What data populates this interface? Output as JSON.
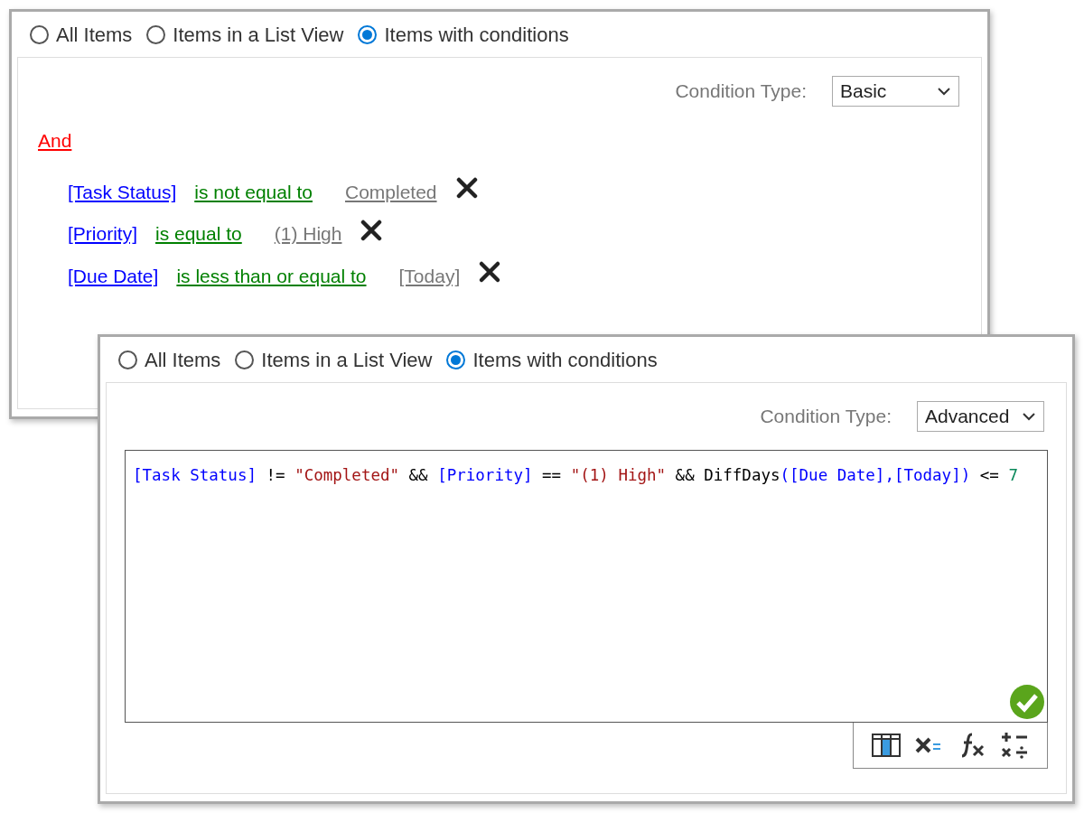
{
  "panels": [
    {
      "kind": "basic",
      "options": [
        {
          "label": "All Items",
          "selected": false
        },
        {
          "label": "Items in a List View",
          "selected": false
        },
        {
          "label": "Items with conditions",
          "selected": true
        }
      ],
      "condition_type": {
        "label": "Condition Type:",
        "value": "Basic"
      },
      "group": "And",
      "conditions": [
        {
          "field": "[Task Status]",
          "operator": "is not equal to",
          "value": "Completed"
        },
        {
          "field": "[Priority]",
          "operator": "is equal to",
          "value": "(1) High"
        },
        {
          "field": "[Due Date]",
          "operator": "is less than or equal to",
          "value": "[Today]"
        }
      ]
    },
    {
      "kind": "advanced",
      "options": [
        {
          "label": "All Items",
          "selected": false
        },
        {
          "label": "Items in a List View",
          "selected": false
        },
        {
          "label": "Items with conditions",
          "selected": true
        }
      ],
      "condition_type": {
        "label": "Condition Type:",
        "value": "Advanced"
      },
      "expression": [
        {
          "kind": "field",
          "text": "[Task Status]"
        },
        {
          "kind": "operator",
          "text": " != "
        },
        {
          "kind": "string",
          "text": "\"Completed\""
        },
        {
          "kind": "operator",
          "text": " && "
        },
        {
          "kind": "field",
          "text": "[Priority]"
        },
        {
          "kind": "operator",
          "text": " == "
        },
        {
          "kind": "string",
          "text": "\"(1) High\""
        },
        {
          "kind": "operator",
          "text": " && DiffDays"
        },
        {
          "kind": "field",
          "text": "([Due Date],[Today])"
        },
        {
          "kind": "operator",
          "text": " <= "
        },
        {
          "kind": "number",
          "text": "7"
        }
      ]
    }
  ]
}
